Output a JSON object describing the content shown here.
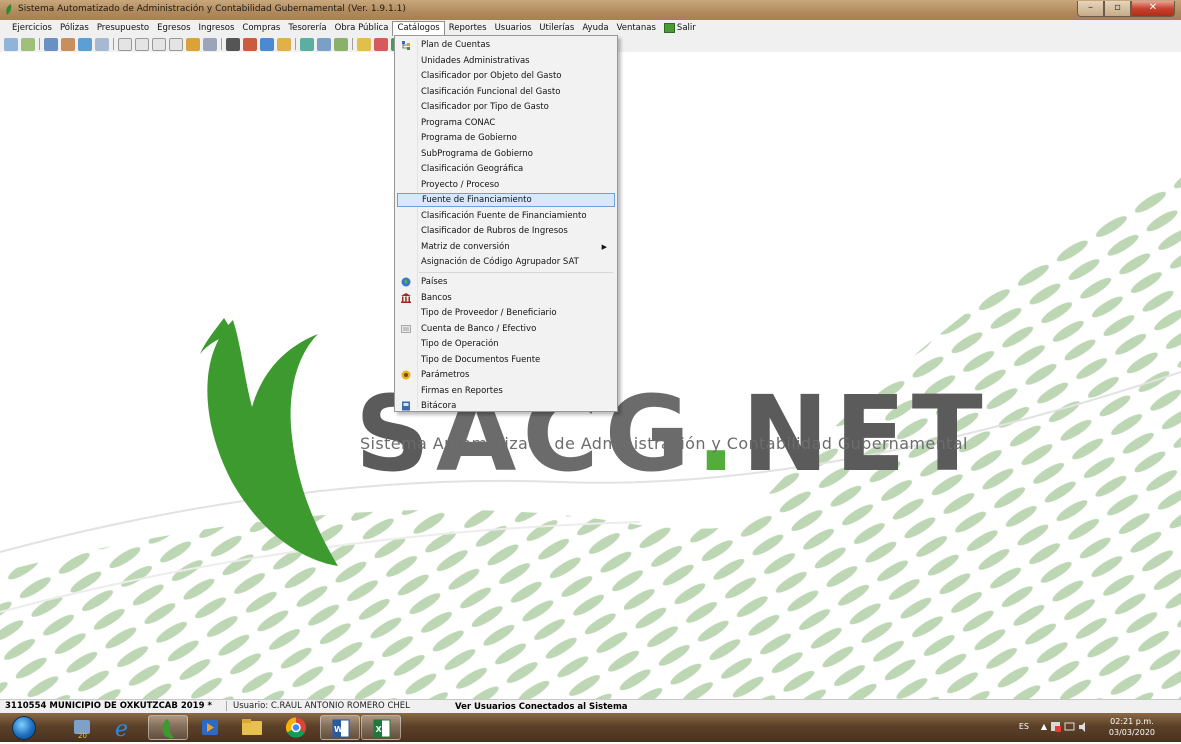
{
  "window": {
    "title": "Sistema Automatizado de Administración y Contabilidad Gubernamental  (Ver. 1.9.1.1)"
  },
  "menubar": {
    "items": [
      "Ejercicios",
      "Pólizas",
      "Presupuesto",
      "Egresos",
      "Ingresos",
      "Compras",
      "Tesorería",
      "Obra Pública",
      "Catálogos",
      "Reportes",
      "Usuarios",
      "Utilerías",
      "Ayuda",
      "Ventanas"
    ],
    "active": "Catálogos",
    "exit_label": "Salir"
  },
  "catalogos_menu": {
    "group1": [
      "Plan de Cuentas",
      "Unidades Administrativas",
      "Clasificador por Objeto del Gasto",
      "Clasificación Funcional del Gasto",
      "Clasificador por Tipo de Gasto",
      "Programa CONAC",
      "Programa de Gobierno",
      "SubPrograma de Gobierno",
      "Clasificación Geográfica",
      "Proyecto / Proceso",
      "Fuente de Financiamiento",
      "Clasificación Fuente de Financiamiento",
      "Clasificador de Rubros de Ingresos",
      "Matriz de conversión",
      "Asignación de Código Agrupador SAT"
    ],
    "group2": [
      "Países",
      "Bancos",
      "Tipo de Proveedor / Beneficiario",
      "Cuenta de Banco / Efectivo",
      "Tipo de Operación",
      "Tipo de Documentos Fuente",
      "Parámetros",
      "Firmas en Reportes",
      "Bitácora"
    ],
    "highlighted": "Fuente de Financiamiento",
    "submenu_item": "Matriz de conversión"
  },
  "branding": {
    "logo_text_a": "S",
    "logo_text_b": "ACG",
    "logo_dot": ".",
    "logo_text_c": "NET",
    "subtitle": "Sistema Automatizado de Administración y Contabilidad Gubernamental",
    "green": "#53ad3c"
  },
  "statusbar": {
    "entity": "3110554 MUNICIPIO DE OXKUTZCAB  2019  *",
    "user": "Usuario: C.RAUL ANTONIO ROMERO CHEL",
    "link": "Ver Usuarios Conectados al Sistema"
  },
  "taskbar": {
    "language": "ES",
    "time": "02:21 p.m.",
    "date": "03/03/2020"
  }
}
